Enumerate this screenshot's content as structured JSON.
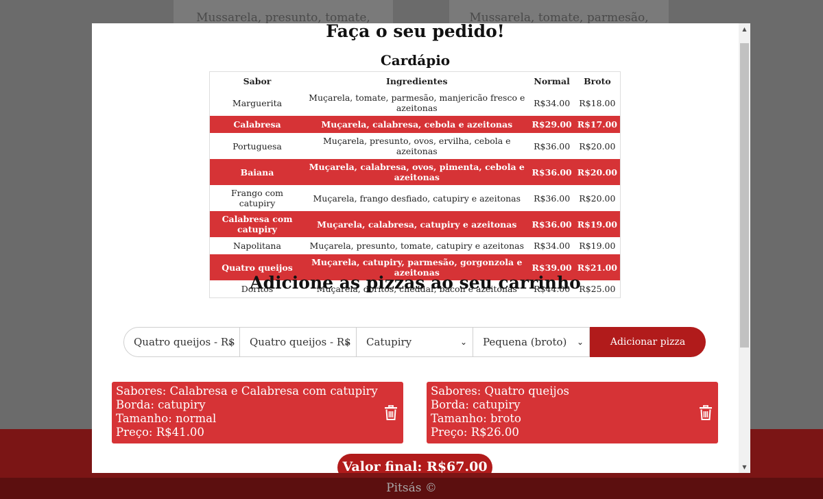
{
  "background": {
    "card_left_text": "Mussarela, presunto, tomate, catupiry",
    "card_right_text": "Mussarela, tomate, parmesão,",
    "footer": "Pitsás ©"
  },
  "modal": {
    "title": "Faça o seu pedido!",
    "menu_title": "Cardápio",
    "columns": [
      "Sabor",
      "Ingredientes",
      "Normal",
      "Broto"
    ],
    "rows": [
      [
        "Marguerita",
        "Muçarela, tomate, parmesão, manjericão fresco e azeitonas",
        "R$34.00",
        "R$18.00"
      ],
      [
        "Calabresa",
        "Muçarela, calabresa, cebola e azeitonas",
        "R$29.00",
        "R$17.00"
      ],
      [
        "Portuguesa",
        "Muçarela, presunto, ovos, ervilha, cebola e azeitonas",
        "R$36.00",
        "R$20.00"
      ],
      [
        "Baiana",
        "Muçarela, calabresa, ovos, pimenta, cebola e azeitonas",
        "R$36.00",
        "R$20.00"
      ],
      [
        "Frango com catupiry",
        "Muçarela, frango desfiado, catupiry e azeitonas",
        "R$36.00",
        "R$20.00"
      ],
      [
        "Calabresa com catupiry",
        "Muçarela, calabresa, catupiry e azeitonas",
        "R$36.00",
        "R$19.00"
      ],
      [
        "Napolitana",
        "Muçarela, presunto, tomate, catupiry e azeitonas",
        "R$34.00",
        "R$19.00"
      ],
      [
        "Quatro queijos",
        "Muçarela, catupiry, parmesão, gorgonzola e azeitonas",
        "R$39.00",
        "R$21.00"
      ],
      [
        "Doritos",
        "Muçarela, doritos, cheddar, bacon e azeitonas",
        "R$44.00",
        "R$25.00"
      ]
    ],
    "cart_title": "Adicione as pizzas ao seu carrinho",
    "form": {
      "flavor1": "Quatro queijos - R$",
      "flavor2": "Quatro queijos - R$",
      "crust": "Catupiry",
      "size": "Pequena (broto)",
      "add_button": "Adicionar pizza"
    },
    "cart": [
      {
        "flavors": "Sabores: Calabresa e Calabresa com catupiry",
        "crust": "Borda: catupiry",
        "size": "Tamanho: normal",
        "price": "Preço: R$41.00"
      },
      {
        "flavors": "Sabores: Quatro queijos",
        "crust": "Borda: catupiry",
        "size": "Tamanho: broto",
        "price": "Preço: R$26.00"
      }
    ],
    "total": "Valor final: R$67.00"
  },
  "colors": {
    "accent_red": "#d63336",
    "dark_red": "#b11b1b"
  }
}
